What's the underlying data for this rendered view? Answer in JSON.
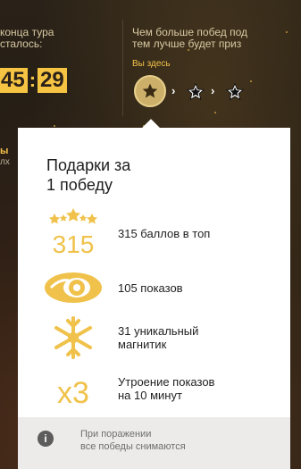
{
  "header": {
    "timer_label": "конца тура\nсталось:",
    "timer_minutes": "45",
    "timer_separator": ":",
    "timer_seconds": "29",
    "prize_label": "Чем больше побед под\nтем лучше будет приз",
    "here_label": "Вы здесь"
  },
  "side": {
    "text_1": "ы",
    "text_2": "лх"
  },
  "popup": {
    "title": "Подарки за\n1 победу",
    "rewards": [
      {
        "icon": "stars-315-icon",
        "icon_text": "315",
        "label": "315 баллов в топ"
      },
      {
        "icon": "eye-icon",
        "label": "105 показов"
      },
      {
        "icon": "snowflake-icon",
        "label": "31 уникальный\nмагнитик"
      },
      {
        "icon": "x3-multiplier-icon",
        "icon_text": "x3",
        "label": "Утроение показов\nна 10 минут"
      }
    ],
    "footer_text": "При поражении\nвсе победы снимаются"
  },
  "colors": {
    "accent_gold": "#f6c443",
    "icon_gold": "#f0c24b",
    "card_bg": "#ffffff",
    "footer_bg": "#ecebea"
  }
}
